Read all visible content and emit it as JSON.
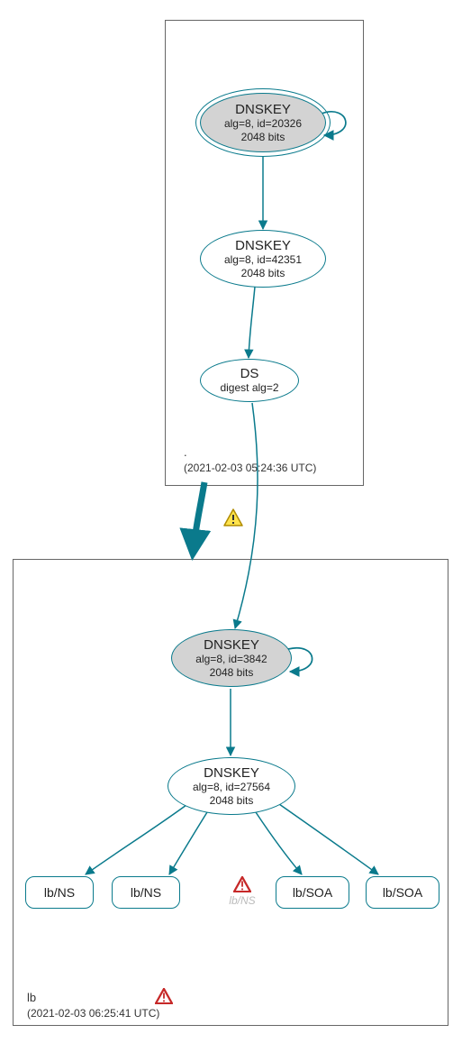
{
  "zones": {
    "root": {
      "name": ".",
      "timestamp": "(2021-02-03 05:24:36 UTC)"
    },
    "lb": {
      "name": "lb",
      "timestamp": "(2021-02-03 06:25:41 UTC)"
    }
  },
  "nodes": {
    "ksk_root": {
      "title": "DNSKEY",
      "line1": "alg=8, id=20326",
      "line2": "2048 bits"
    },
    "zsk_root": {
      "title": "DNSKEY",
      "line1": "alg=8, id=42351",
      "line2": "2048 bits"
    },
    "ds": {
      "title": "DS",
      "line1": "digest alg=2"
    },
    "ksk_lb": {
      "title": "DNSKEY",
      "line1": "alg=8, id=3842",
      "line2": "2048 bits"
    },
    "zsk_lb": {
      "title": "DNSKEY",
      "line1": "alg=8, id=27564",
      "line2": "2048 bits"
    },
    "rr1": {
      "label": "lb/NS"
    },
    "rr2": {
      "label": "lb/NS"
    },
    "rr3": {
      "label": "lb/NS"
    },
    "rr4": {
      "label": "lb/SOA"
    },
    "rr5": {
      "label": "lb/SOA"
    }
  },
  "chart_data": {
    "type": "graph",
    "description": "DNSSEC authentication chain",
    "zones": [
      {
        "name": ".",
        "timestamp": "2021-02-03 05:24:36 UTC"
      },
      {
        "name": "lb",
        "timestamp": "2021-02-03 06:25:41 UTC",
        "status": "error"
      }
    ],
    "nodes": [
      {
        "id": "ksk_root",
        "zone": ".",
        "type": "DNSKEY",
        "alg": 8,
        "key_id": 20326,
        "bits": 2048,
        "sep": true,
        "self_loop": true
      },
      {
        "id": "zsk_root",
        "zone": ".",
        "type": "DNSKEY",
        "alg": 8,
        "key_id": 42351,
        "bits": 2048
      },
      {
        "id": "ds",
        "zone": ".",
        "type": "DS",
        "digest_alg": 2
      },
      {
        "id": "ksk_lb",
        "zone": "lb",
        "type": "DNSKEY",
        "alg": 8,
        "key_id": 3842,
        "bits": 2048,
        "sep": true,
        "self_loop": true
      },
      {
        "id": "zsk_lb",
        "zone": "lb",
        "type": "DNSKEY",
        "alg": 8,
        "key_id": 27564,
        "bits": 2048
      },
      {
        "id": "rr1",
        "zone": "lb",
        "type": "RRset",
        "label": "lb/NS"
      },
      {
        "id": "rr2",
        "zone": "lb",
        "type": "RRset",
        "label": "lb/NS"
      },
      {
        "id": "rr3",
        "zone": "lb",
        "type": "RRset",
        "label": "lb/NS",
        "status": "error"
      },
      {
        "id": "rr4",
        "zone": "lb",
        "type": "RRset",
        "label": "lb/SOA"
      },
      {
        "id": "rr5",
        "zone": "lb",
        "type": "RRset",
        "label": "lb/SOA"
      }
    ],
    "edges": [
      {
        "from": "ksk_root",
        "to": "ksk_root"
      },
      {
        "from": "ksk_root",
        "to": "zsk_root"
      },
      {
        "from": "zsk_root",
        "to": "ds"
      },
      {
        "from": "ds",
        "to": "ksk_lb"
      },
      {
        "from": "ksk_lb",
        "to": "ksk_lb"
      },
      {
        "from": "ksk_lb",
        "to": "zsk_lb"
      },
      {
        "from": "zsk_lb",
        "to": "rr1"
      },
      {
        "from": "zsk_lb",
        "to": "rr2"
      },
      {
        "from": "zsk_lb",
        "to": "rr4"
      },
      {
        "from": "zsk_lb",
        "to": "rr5"
      },
      {
        "from_zone": ".",
        "to_zone": "lb",
        "status": "warning",
        "style": "thick"
      }
    ]
  }
}
